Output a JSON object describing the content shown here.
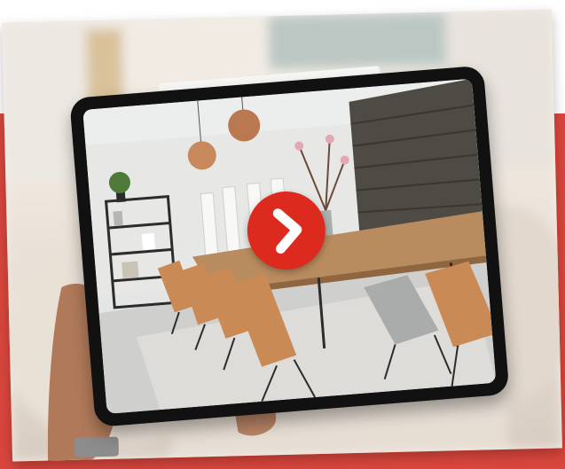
{
  "colors": {
    "accent_red": "#d9463d",
    "play_red": "#dd2a1e",
    "tablet_frame": "#111111",
    "wood": "#b98c5f",
    "chair_leather": "#c98a56",
    "stone_wall": "#4e4a44"
  },
  "scene": {
    "description_icon": "tablet-with-dining-room-photo",
    "play_icon": "chevron-right-icon"
  }
}
